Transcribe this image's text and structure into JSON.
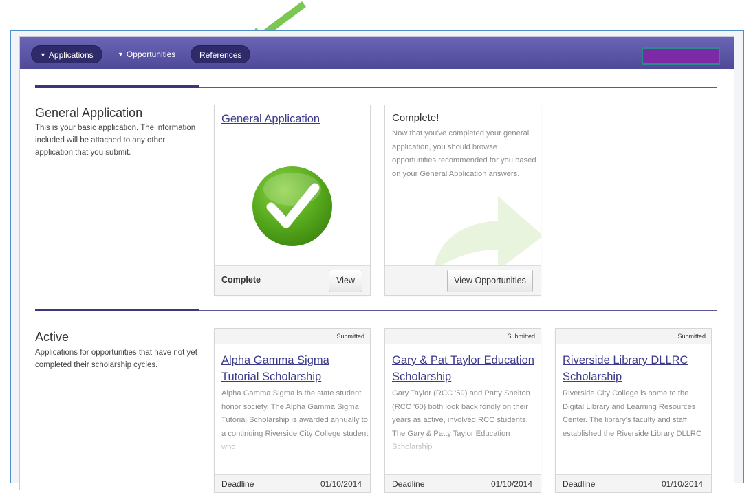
{
  "nav": {
    "applications_label": "Applications",
    "opportunities_label": "Opportunities",
    "references_label": "References"
  },
  "colors": {
    "navbar": "#5b56a8",
    "pill": "#2f2b6a",
    "link": "#3c3a8a",
    "annotation_arrow": "#7cc653",
    "check_green": "#5aab1f"
  },
  "general": {
    "title": "General Application",
    "description": "This is your basic application. The information included will be attached to any other application that you submit.",
    "card": {
      "link": "General Application",
      "status": "Complete",
      "button": "View",
      "icon": "checkmark-icon"
    },
    "complete_card": {
      "title": "Complete!",
      "text": "Now that you've completed your general application, you should browse opportunities recommended for you based on your General Application answers.",
      "button": "View Opportunities",
      "icon": "arrow-right-icon"
    }
  },
  "active": {
    "title": "Active",
    "description": "Applications for opportunities that have not yet completed their scholarship cycles.",
    "deadline_label": "Deadline",
    "cards": [
      {
        "status": "Submitted",
        "title": "Alpha Gamma Sigma Tutorial Scholarship",
        "text": "Alpha Gamma Sigma is the state student honor society. The Alpha Gamma Sigma Tutorial Scholarship is awarded annually to a continuing Riverside City College student who",
        "deadline": "01/10/2014"
      },
      {
        "status": "Submitted",
        "title": "Gary & Pat Taylor Education Scholarship",
        "text": "Gary Taylor (RCC '59) and Patty Shelton (RCC '60) both look back fondly on their years as active, involved RCC students. The Gary & Patty Taylor Education Scholarship",
        "deadline": "01/10/2014"
      },
      {
        "status": "Submitted",
        "title": "Riverside Library DLLRC Scholarship",
        "text": "Riverside City College is home to the Digital Library and Learning Resources Center. The library's faculty and staff established the Riverside Library DLLRC",
        "deadline": "01/10/2014"
      }
    ]
  }
}
